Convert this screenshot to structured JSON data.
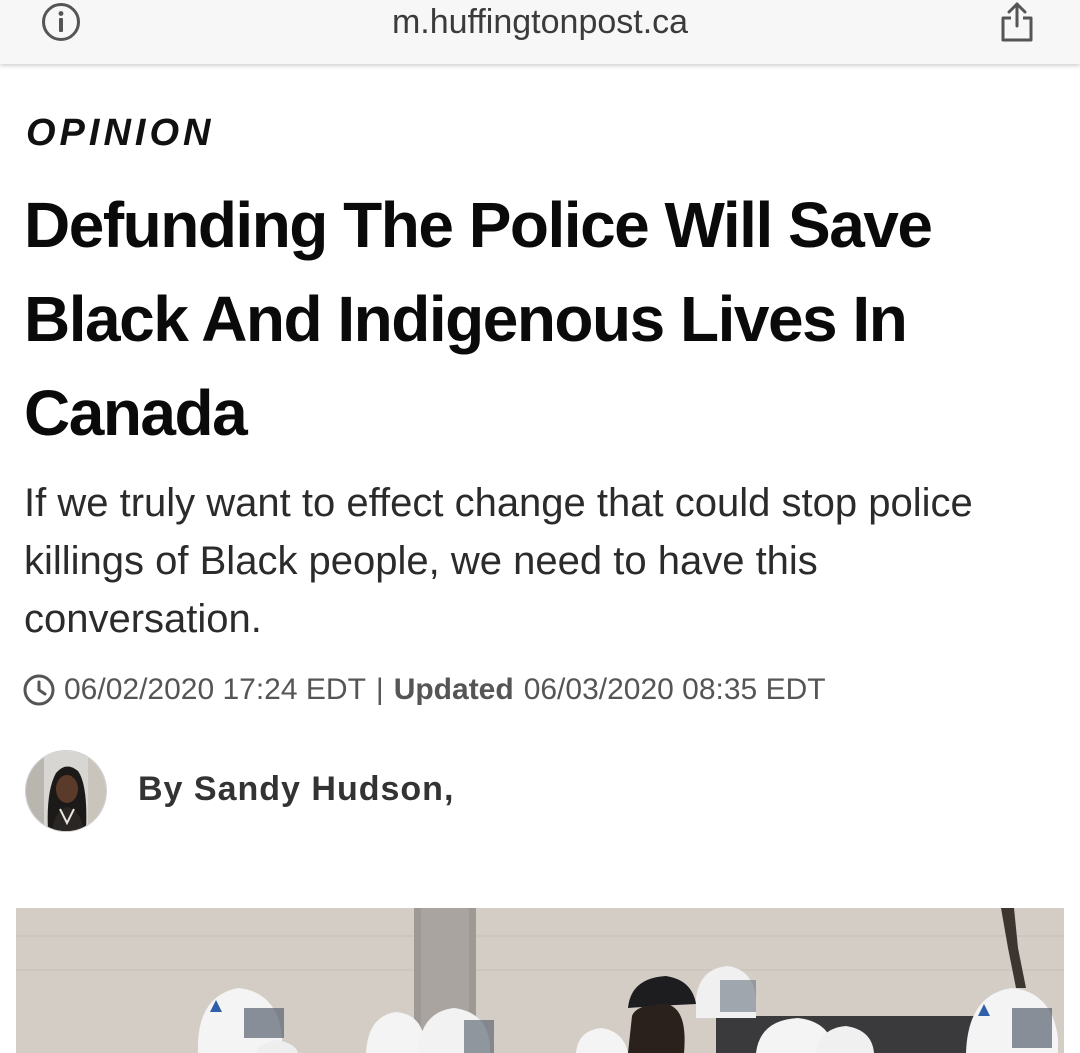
{
  "browser": {
    "url": "m.huffingtonpost.ca",
    "info_icon": "info-circle-icon",
    "share_icon": "share-icon"
  },
  "article": {
    "section": "OPINION",
    "headline": "Defunding The Police Will Save Black And Indigenous Lives In Canada",
    "dek": "If we truly want to effect change that could stop police killings of Black people, we need to have this conversation.",
    "published": "06/02/2020 17:24 EDT",
    "separator": "|",
    "updated_label": "Updated",
    "updated": "06/03/2020 08:35 EDT",
    "byline_prefix": "By",
    "author": "Sandy Hudson,"
  },
  "colors": {
    "url_bar_bg": "#f7f7f7",
    "headline": "#0a0a0a",
    "dek": "#2b2b2b",
    "meta": "#555555",
    "byline": "#333333",
    "police_helmet": "#ffffff",
    "helmet_stripe": "#2f5fa8"
  }
}
